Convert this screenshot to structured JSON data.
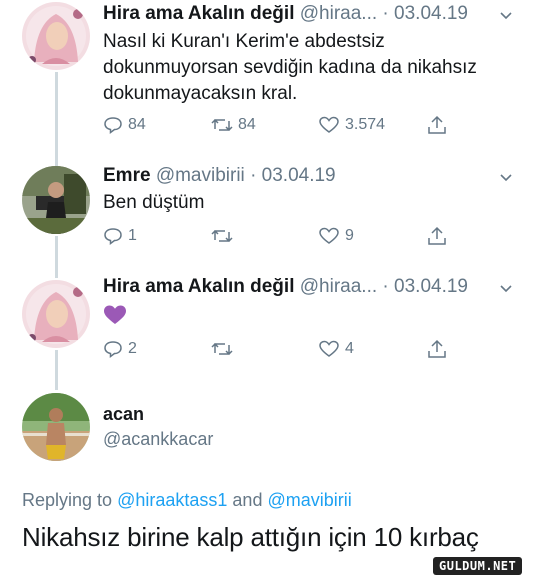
{
  "tweets": [
    {
      "name": "Hira ama Akalın değil",
      "handle": "@hiraa...",
      "date": "· 03.04.19",
      "text_lines": [
        "Nasıl ki Kuran'ı Kerim'e abdestsiz",
        "dokunmuyorsan sevdiğin kadına da nikahsız",
        "dokunmayacaksın kral."
      ],
      "replies": "84",
      "retweets": "84",
      "likes": "3.574"
    },
    {
      "name": "Emre",
      "handle": "@mavibirii",
      "date": "· 03.04.19",
      "text_lines": [
        "Ben düştüm"
      ],
      "replies": "1",
      "retweets": "",
      "likes": "9"
    },
    {
      "name": "Hira ama Akalın değil",
      "handle": "@hiraa...",
      "date": "· 03.04.19",
      "text_lines": [
        "💜"
      ],
      "replies": "2",
      "retweets": "",
      "likes": "4"
    }
  ],
  "reply_author": {
    "name": "acan",
    "handle": "@acankkacar"
  },
  "replying_to": {
    "prefix": "Replying to",
    "handle1": "@hiraaktass1",
    "conj": "and",
    "handle2": "@mavibirii"
  },
  "reply_text": "Nikahsız birine kalp attığın için 10 kırbaç",
  "watermark": "GULDUM.NET",
  "colors": {
    "text": "#14171a",
    "meta": "#657786",
    "link": "#1da1f2",
    "purple_heart": "#9b59b6"
  }
}
